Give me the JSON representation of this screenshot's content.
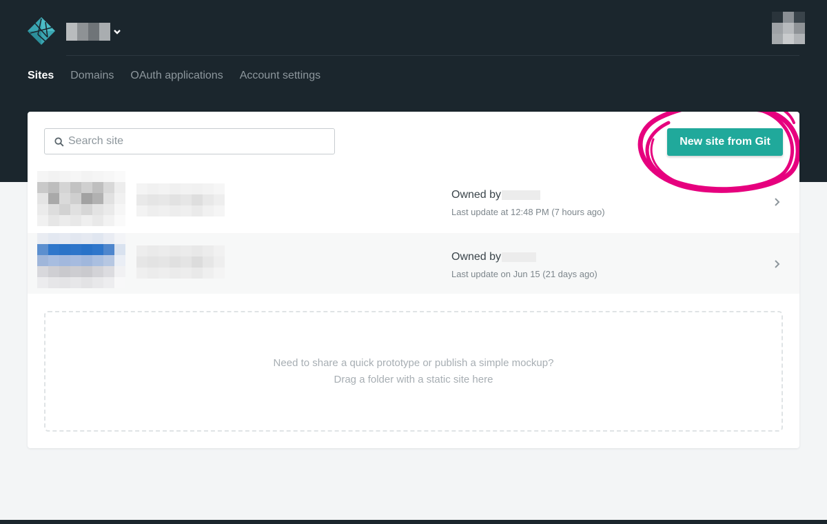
{
  "header": {
    "team_name": "",
    "avatar_alt": ""
  },
  "nav": {
    "items": [
      {
        "label": "Sites",
        "active": true
      },
      {
        "label": "Domains",
        "active": false
      },
      {
        "label": "OAuth applications",
        "active": false
      },
      {
        "label": "Account settings",
        "active": false
      }
    ]
  },
  "toolbar": {
    "search_placeholder": "Search site",
    "new_site_label": "New site from Git"
  },
  "sites": [
    {
      "owned_by_label": "Owned by",
      "last_update": "Last update at 12:48 PM (7 hours ago)"
    },
    {
      "owned_by_label": "Owned by",
      "last_update": "Last update on Jun 15 (21 days ago)"
    }
  ],
  "dropzone": {
    "line1": "Need to share a quick prototype or publish a simple mockup?",
    "line2": "Drag a folder with a static site here"
  },
  "colors": {
    "header_bg": "#1b262d",
    "accent": "#20a99b",
    "annotation": "#e6007e"
  },
  "icons": {
    "logo": "netlify-logo",
    "search": "search-icon",
    "row_chevron": "chevron-right-icon",
    "team_chevron": "chevron-down-icon"
  }
}
